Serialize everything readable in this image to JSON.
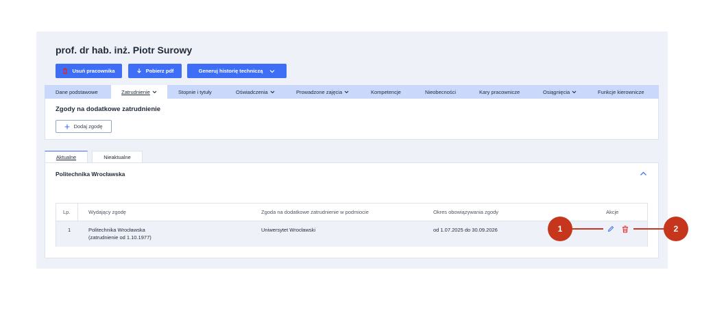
{
  "header": {
    "title": "prof. dr hab. inż. Piotr Surowy"
  },
  "actions": {
    "delete_employee": "Usuń pracownika",
    "download_pdf": "Pobierz pdf",
    "generate_history": "Generuj historię techniczą"
  },
  "nav": {
    "items": [
      {
        "label": "Dane podstawowe"
      },
      {
        "label": "Zatrudnienie"
      },
      {
        "label": "Stopnie i tytuły"
      },
      {
        "label": "Oświadczenia"
      },
      {
        "label": "Prowadzone zajęcia"
      },
      {
        "label": "Kompetencje"
      },
      {
        "label": "Nieobecności"
      },
      {
        "label": "Kary pracownicze"
      },
      {
        "label": "Osiągnięcia"
      },
      {
        "label": "Funkcje kierownicze"
      }
    ]
  },
  "section": {
    "title": "Zgody na dodatkowe zatrudnienie",
    "add_button": "Dodaj zgodę"
  },
  "tabs": [
    {
      "label": "Aktualne"
    },
    {
      "label": "Nieaktualne"
    }
  ],
  "card": {
    "title": "Politechnika Wrocławska"
  },
  "table": {
    "headers": [
      "Lp.",
      "Wydający zgodę",
      "Zgoda na dodatkowe zatrudnienie w podmiocie",
      "Okres obowiązywania zgody",
      "Akcje"
    ],
    "rows": [
      {
        "lp": "1",
        "issuer_line1": "Politechnika Wrocławska",
        "issuer_line2": "(zatrudnienie od 1.10.1977)",
        "entity": "Uniwersytet Wrocławski",
        "period": "od 1.07.2025 do 30.09.2026"
      }
    ]
  },
  "callouts": {
    "edit": "1",
    "delete": "2"
  },
  "colors": {
    "primary": "#3d6ef5",
    "nav_bg": "#c9d8fb",
    "callout": "#c6361d",
    "danger": "#e0251b"
  }
}
